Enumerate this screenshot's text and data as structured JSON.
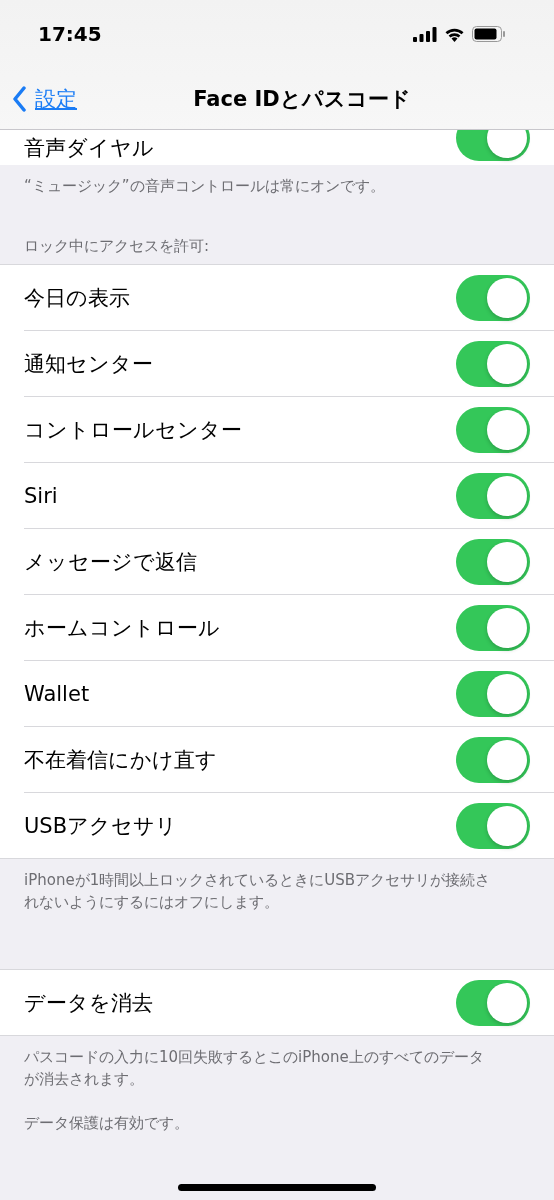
{
  "status_bar": {
    "time": "17:45"
  },
  "nav_bar": {
    "back_label": "設定",
    "title": "Face IDとパスコード"
  },
  "sections": [
    {
      "kind": "scrolled",
      "rows": [
        {
          "label": "音声ダイヤル",
          "on": true
        }
      ],
      "footer": [
        "“ミュージック”の音声コントロールは常にオンです。"
      ]
    },
    {
      "kind": "group",
      "header": "ロック中にアクセスを許可:",
      "rows": [
        {
          "label": "今日の表示",
          "on": true
        },
        {
          "label": "通知センター",
          "on": true
        },
        {
          "label": "コントロールセンター",
          "on": true
        },
        {
          "label": "Siri",
          "on": true
        },
        {
          "label": "メッセージで返信",
          "on": true
        },
        {
          "label": "ホームコントロール",
          "on": true
        },
        {
          "label": "Wallet",
          "on": true
        },
        {
          "label": "不在着信にかけ直す",
          "on": true
        },
        {
          "label": "USBアクセサリ",
          "on": true
        }
      ],
      "footer": [
        "iPhoneが1時間以上ロックされているときにUSBアクセサリが接続されないようにするにはオフにします。"
      ]
    },
    {
      "kind": "group",
      "rows": [
        {
          "label": "データを消去",
          "on": true
        }
      ],
      "footer": [
        "パスコードの入力に10回失敗するとこのiPhone上のすべてのデータが消去されます。",
        "データ保護は有効です。"
      ]
    }
  ]
}
